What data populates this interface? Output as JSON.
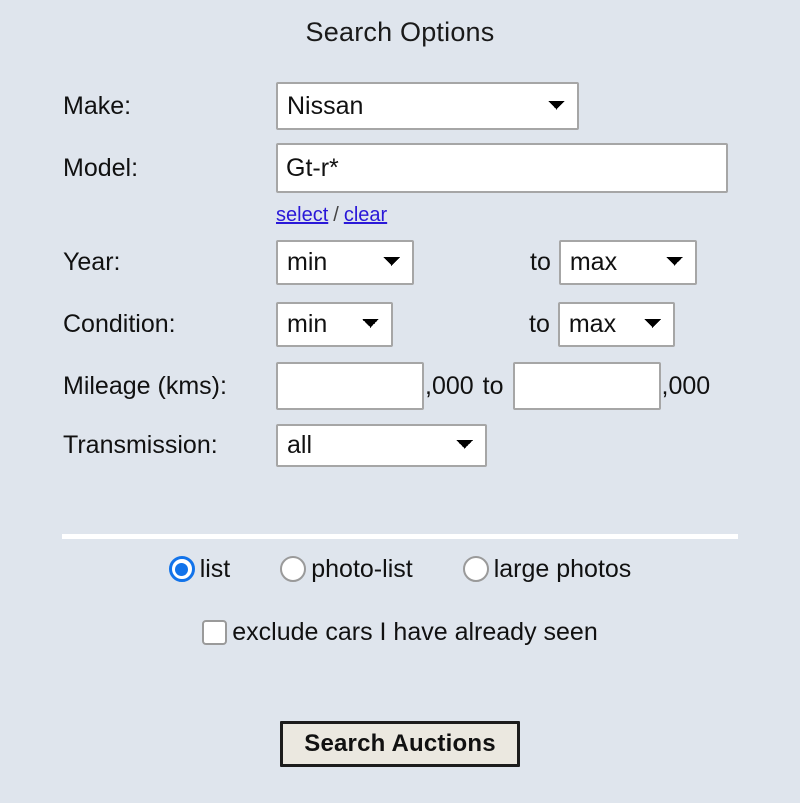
{
  "page": {
    "title": "Search Options",
    "background_color": "#dfe5ed"
  },
  "form": {
    "make": {
      "label": "Make:",
      "value": "Nissan"
    },
    "model": {
      "label": "Model:",
      "value": "Gt-r*",
      "placeholder": "",
      "select_link": "select",
      "separator": "/",
      "clear_link": "clear"
    },
    "year": {
      "label": "Year:",
      "min_value": "min",
      "to_label": "to",
      "max_value": "max"
    },
    "condition": {
      "label": "Condition:",
      "min_value": "min",
      "to_label": "to",
      "max_value": "max"
    },
    "mileage": {
      "label": "Mileage (kms):",
      "min_value": "",
      "min_placeholder": "",
      "min_suffix": ",000",
      "to_label": "to",
      "max_value": "",
      "max_placeholder": "",
      "max_suffix": ",000"
    },
    "transmission": {
      "label": "Transmission:",
      "value": "all"
    }
  },
  "view_options": {
    "selected": "list",
    "accent_color": "#1273ea",
    "radios": [
      {
        "id": "list",
        "label": "list",
        "checked": true
      },
      {
        "id": "photo-list",
        "label": "photo-list",
        "checked": false
      },
      {
        "id": "large-photos",
        "label": "large photos",
        "checked": false
      }
    ]
  },
  "exclude_seen": {
    "label": "exclude cars I have already seen",
    "checked": false
  },
  "submit": {
    "label": "Search Auctions"
  }
}
